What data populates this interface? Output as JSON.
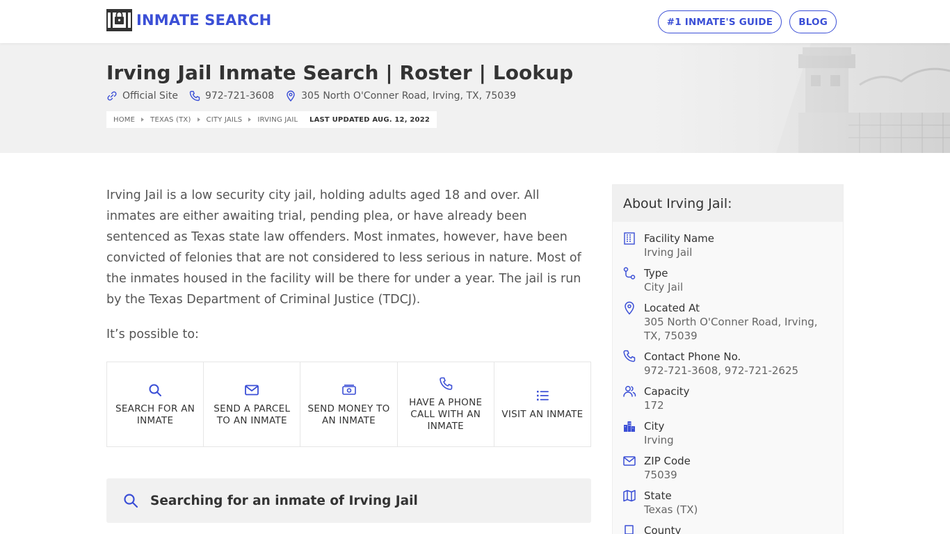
{
  "brand": {
    "name": "INMATE SEARCH"
  },
  "nav": [
    {
      "label": "#1 INMATE'S GUIDE"
    },
    {
      "label": "BLOG"
    }
  ],
  "hero": {
    "title": "Irving Jail Inmate Search | Roster | Lookup",
    "official_site": "Official Site",
    "phone": "972-721-3608",
    "address": "305 North O'Conner Road, Irving, TX, 75039",
    "breadcrumbs": [
      "HOME",
      "TEXAS (TX)",
      "CITY JAILS",
      "IRVING JAIL"
    ],
    "updated": "LAST UPDATED AUG. 12, 2022"
  },
  "main": {
    "intro": "Irving Jail is a low security city jail, holding adults aged 18 and over. All inmates are either awaiting trial, pending plea, or have already been sentenced as Texas state law offenders. Most inmates, however, have been convicted of felonies that are not considered to less serious in nature. Most of the inmates housed in the facility will be there for under a year. The jail is run by the Texas Department of Criminal Justice (TDCJ).",
    "possible": "It’s possible to:",
    "actions": [
      {
        "label": "SEARCH FOR AN INMATE",
        "icon": "search-icon"
      },
      {
        "label": "SEND A PARCEL TO AN INMATE",
        "icon": "envelope-icon"
      },
      {
        "label": "SEND MONEY TO AN INMATE",
        "icon": "money-icon"
      },
      {
        "label": "HAVE A PHONE CALL WITH AN INMATE",
        "icon": "phone-icon"
      },
      {
        "label": "VISIT AN INMATE",
        "icon": "list-icon"
      }
    ],
    "search_title": "Searching for an inmate of Irving Jail"
  },
  "sidebar": {
    "title": "About Irving Jail:",
    "facts": [
      {
        "label": "Facility Name",
        "value": "Irving Jail",
        "icon": "building-icon"
      },
      {
        "label": "Type",
        "value": "City Jail",
        "icon": "route-icon"
      },
      {
        "label": "Located At",
        "value": "305 North O'Conner Road, Irving, TX, 75039",
        "icon": "map-pin-icon"
      },
      {
        "label": "Contact Phone No.",
        "value": "972-721-3608, 972-721-2625",
        "icon": "phone-icon"
      },
      {
        "label": "Capacity",
        "value": "172",
        "icon": "users-icon"
      },
      {
        "label": "City",
        "value": "Irving",
        "icon": "city-icon"
      },
      {
        "label": "ZIP Code",
        "value": "75039",
        "icon": "mail-icon"
      },
      {
        "label": "State",
        "value": "Texas (TX)",
        "icon": "map-icon"
      },
      {
        "label": "County",
        "value": "",
        "icon": "book-icon"
      }
    ]
  },
  "colors": {
    "accent": "#3b4fd6",
    "text": "#333333",
    "muted": "#666666",
    "hero_bg": "#f1f1f1"
  }
}
